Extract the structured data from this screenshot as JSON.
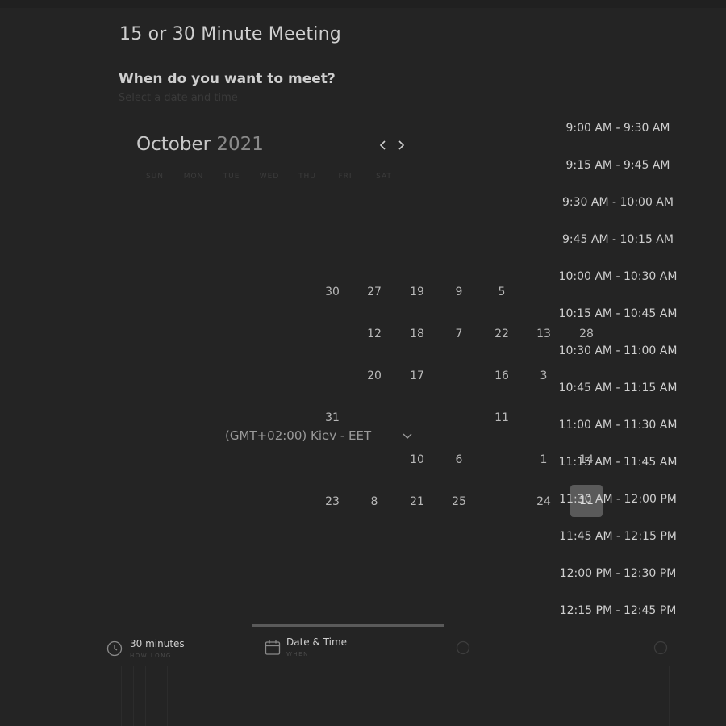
{
  "meeting": {
    "title": "15 or 30 Minute Meeting",
    "question": "When do you want to meet?",
    "subtitle": "Select a date and time"
  },
  "calendar": {
    "month": "October",
    "year": "2021",
    "prev_icon": "chevron-left-icon",
    "next_icon": "chevron-right-icon",
    "weekdays": [
      "SUN",
      "MON",
      "TUE",
      "WED",
      "THU",
      "FRI",
      "SAT"
    ],
    "days": [
      {
        "label": "30"
      },
      {
        "label": "27"
      },
      {
        "label": "19"
      },
      {
        "label": "9"
      },
      {
        "label": "5"
      },
      {
        "label": "12"
      },
      {
        "label": "18"
      },
      {
        "label": "7"
      },
      {
        "label": "22"
      },
      {
        "label": "13"
      },
      {
        "label": "28"
      },
      {
        "label": "20"
      },
      {
        "label": "17"
      },
      {
        "label": "16"
      },
      {
        "label": "3"
      },
      {
        "label": "31"
      },
      {
        "label": "11"
      },
      {
        "label": "10"
      },
      {
        "label": "6"
      },
      {
        "label": "1"
      },
      {
        "label": "14"
      },
      {
        "label": "23"
      },
      {
        "label": "8"
      },
      {
        "label": "21"
      },
      {
        "label": "25"
      },
      {
        "label": "24"
      },
      {
        "label": "11",
        "selected": true
      }
    ]
  },
  "timezone": {
    "label": "(GMT+02:00) Kiev - EET",
    "chevron_icon": "chevron-down-icon"
  },
  "time_slots": [
    "9:00 AM - 9:30 AM",
    "9:15 AM - 9:45 AM",
    "9:30 AM - 10:00 AM",
    "9:45 AM - 10:15 AM",
    "10:00 AM - 10:30 AM",
    "10:15 AM - 10:45 AM",
    "10:30 AM - 11:00 AM",
    "10:45 AM - 11:15 AM",
    "11:00 AM - 11:30 AM",
    "11:15 AM - 11:45 AM",
    "11:30 AM - 12:00 PM",
    "11:45 AM - 12:15 PM",
    "12:00 PM - 12:30 PM",
    "12:15 PM - 12:45 PM"
  ],
  "steps": [
    {
      "title": "30 minutes",
      "subtitle": "HOW LONG",
      "icon": "clock-icon"
    },
    {
      "title": "Date & Time",
      "subtitle": "WHEN",
      "icon": "calendar-icon"
    }
  ]
}
